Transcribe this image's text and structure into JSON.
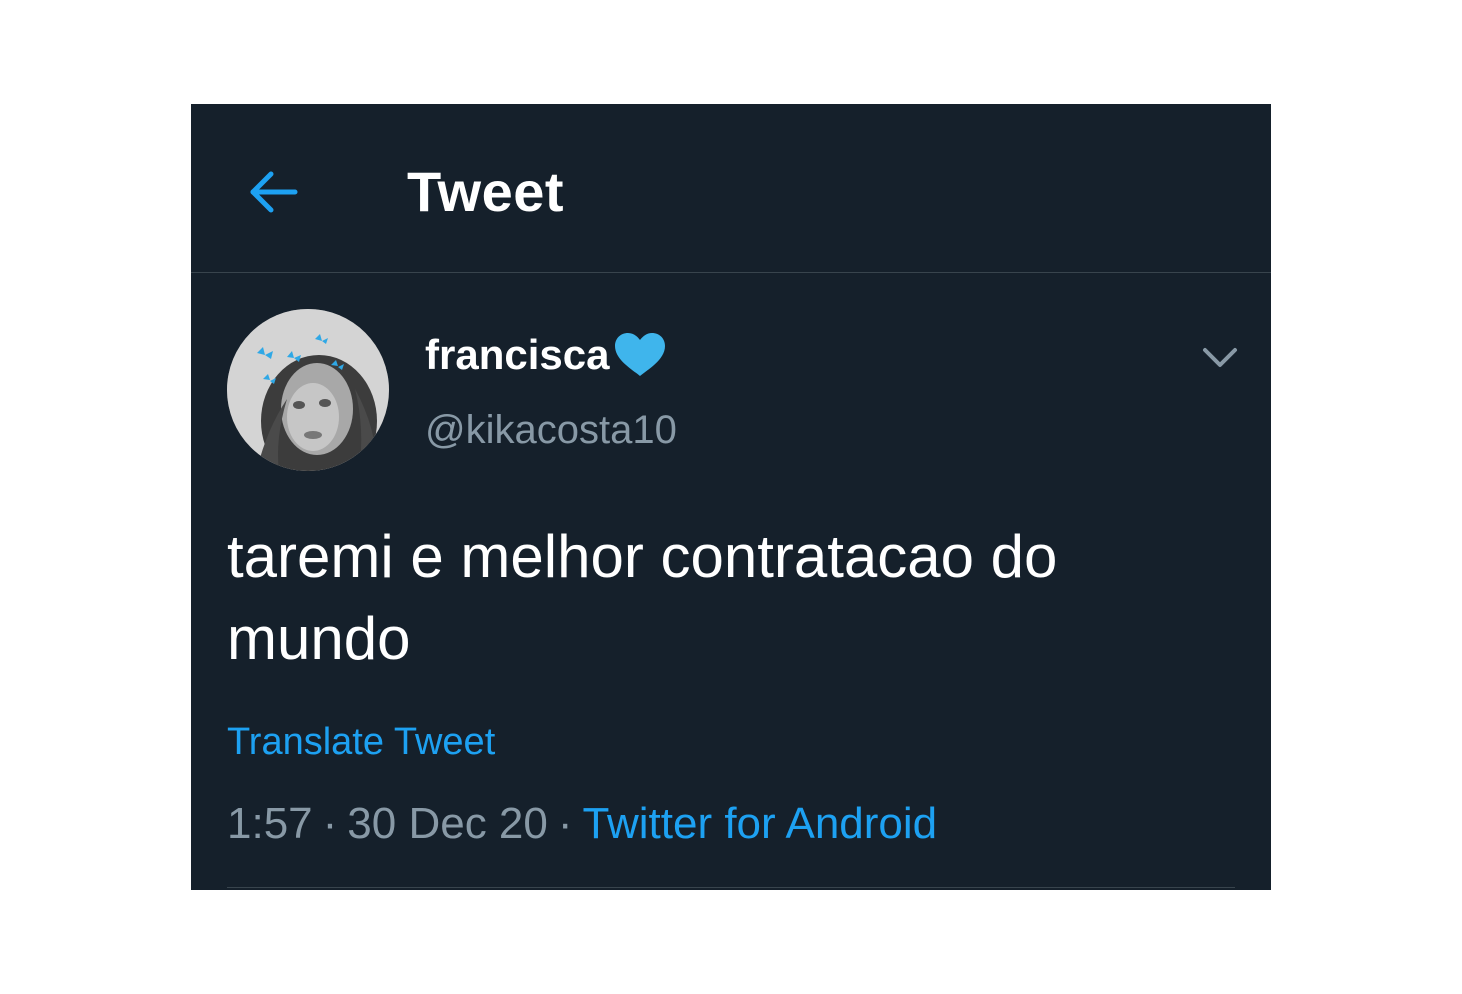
{
  "header": {
    "back_icon": "arrow-left-icon",
    "title": "Tweet"
  },
  "tweet": {
    "author": {
      "display_name": "francisca",
      "name_emoji": "blue-heart-icon",
      "handle": "@kikacosta10"
    },
    "menu_icon": "chevron-down-icon",
    "text_line1": "taremi e melhor contratacao do",
    "text_line2": "mundo",
    "translate_label": "Translate Tweet",
    "time": "1:57",
    "date": "30 Dec 20",
    "separator": "·",
    "source": "Twitter for Android"
  },
  "colors": {
    "background": "#15202b",
    "accent": "#1da1f2",
    "secondary_text": "#8899a6",
    "heart": "#3fb5ec"
  }
}
